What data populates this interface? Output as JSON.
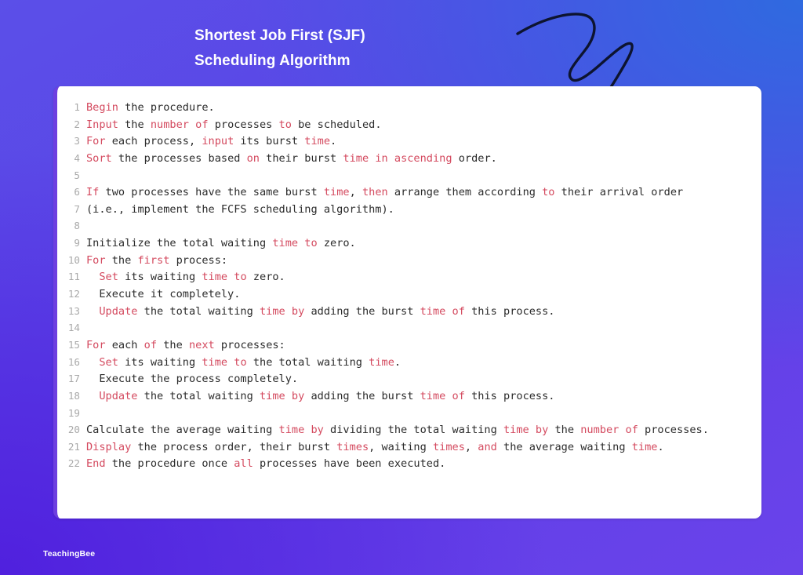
{
  "background": {
    "gradient_from": "#5b4fe8",
    "gradient_to": "#3169dc",
    "gradient_accent": "#5020de"
  },
  "title": {
    "line1": "Shortest Job First (SJF)",
    "line2": "Scheduling Algorithm",
    "color": "#ffffff"
  },
  "doodle": {
    "name": "hand-drawn-squiggle-arrow",
    "color": "#0d1430",
    "direction": "down-left"
  },
  "brand": {
    "name": "TeachingBee",
    "color": "#ffffff"
  },
  "code_card": {
    "background": "#ffffff",
    "accent_border": "#6d3fe0",
    "keyword_color": "#d44a5f",
    "text_color": "#2b2b2b",
    "line_number_color": "#a9a9a9",
    "language": "pseudocode",
    "total_lines": 22,
    "lines": [
      {
        "n": "1",
        "tokens": [
          {
            "t": "Begin",
            "k": true
          },
          {
            "t": " the procedure.",
            "k": false
          }
        ]
      },
      {
        "n": "2",
        "tokens": [
          {
            "t": "Input",
            "k": true
          },
          {
            "t": " the ",
            "k": false
          },
          {
            "t": "number",
            "k": true
          },
          {
            "t": " ",
            "k": false
          },
          {
            "t": "of",
            "k": true
          },
          {
            "t": " processes ",
            "k": false
          },
          {
            "t": "to",
            "k": true
          },
          {
            "t": " be scheduled.",
            "k": false
          }
        ]
      },
      {
        "n": "3",
        "tokens": [
          {
            "t": "For",
            "k": true
          },
          {
            "t": " each process, ",
            "k": false
          },
          {
            "t": "input",
            "k": true
          },
          {
            "t": " its burst ",
            "k": false
          },
          {
            "t": "time",
            "k": true
          },
          {
            "t": ".",
            "k": false
          }
        ]
      },
      {
        "n": "4",
        "tokens": [
          {
            "t": "Sort",
            "k": true
          },
          {
            "t": " the processes based ",
            "k": false
          },
          {
            "t": "on",
            "k": true
          },
          {
            "t": " their burst ",
            "k": false
          },
          {
            "t": "time in ascending",
            "k": true
          },
          {
            "t": " order.",
            "k": false
          }
        ]
      },
      {
        "n": "5",
        "tokens": [
          {
            "t": "",
            "k": false
          }
        ]
      },
      {
        "n": "6",
        "tokens": [
          {
            "t": "If",
            "k": true
          },
          {
            "t": " two processes have the same burst ",
            "k": false
          },
          {
            "t": "time",
            "k": true
          },
          {
            "t": ", ",
            "k": false
          },
          {
            "t": "then",
            "k": true
          },
          {
            "t": " arrange them according ",
            "k": false
          },
          {
            "t": "to",
            "k": true
          },
          {
            "t": " their arrival order",
            "k": false
          }
        ]
      },
      {
        "n": "7",
        "tokens": [
          {
            "t": "(i.e., implement the FCFS scheduling algorithm).",
            "k": false
          }
        ]
      },
      {
        "n": "8",
        "tokens": [
          {
            "t": "",
            "k": false
          }
        ]
      },
      {
        "n": "9",
        "tokens": [
          {
            "t": "Initialize the total waiting ",
            "k": false
          },
          {
            "t": "time to",
            "k": true
          },
          {
            "t": " zero.",
            "k": false
          }
        ]
      },
      {
        "n": "10",
        "tokens": [
          {
            "t": "For",
            "k": true
          },
          {
            "t": " the ",
            "k": false
          },
          {
            "t": "first",
            "k": true
          },
          {
            "t": " process:",
            "k": false
          }
        ]
      },
      {
        "n": "11",
        "tokens": [
          {
            "t": "  ",
            "k": false
          },
          {
            "t": "Set",
            "k": true
          },
          {
            "t": " its waiting ",
            "k": false
          },
          {
            "t": "time to",
            "k": true
          },
          {
            "t": " zero.",
            "k": false
          }
        ]
      },
      {
        "n": "12",
        "tokens": [
          {
            "t": "  Execute it completely.",
            "k": false
          }
        ]
      },
      {
        "n": "13",
        "tokens": [
          {
            "t": "  ",
            "k": false
          },
          {
            "t": "Update",
            "k": true
          },
          {
            "t": " the total waiting ",
            "k": false
          },
          {
            "t": "time by",
            "k": true
          },
          {
            "t": " adding the burst ",
            "k": false
          },
          {
            "t": "time of",
            "k": true
          },
          {
            "t": " this process.",
            "k": false
          }
        ]
      },
      {
        "n": "14",
        "tokens": [
          {
            "t": "",
            "k": false
          }
        ]
      },
      {
        "n": "15",
        "tokens": [
          {
            "t": "For",
            "k": true
          },
          {
            "t": " each ",
            "k": false
          },
          {
            "t": "of",
            "k": true
          },
          {
            "t": " the ",
            "k": false
          },
          {
            "t": "next",
            "k": true
          },
          {
            "t": " processes:",
            "k": false
          }
        ]
      },
      {
        "n": "16",
        "tokens": [
          {
            "t": "  ",
            "k": false
          },
          {
            "t": "Set",
            "k": true
          },
          {
            "t": " its waiting ",
            "k": false
          },
          {
            "t": "time to",
            "k": true
          },
          {
            "t": " the total waiting ",
            "k": false
          },
          {
            "t": "time",
            "k": true
          },
          {
            "t": ".",
            "k": false
          }
        ]
      },
      {
        "n": "17",
        "tokens": [
          {
            "t": "  Execute the process completely.",
            "k": false
          }
        ]
      },
      {
        "n": "18",
        "tokens": [
          {
            "t": "  ",
            "k": false
          },
          {
            "t": "Update",
            "k": true
          },
          {
            "t": " the total waiting ",
            "k": false
          },
          {
            "t": "time by",
            "k": true
          },
          {
            "t": " adding the burst ",
            "k": false
          },
          {
            "t": "time of",
            "k": true
          },
          {
            "t": " this process.",
            "k": false
          }
        ]
      },
      {
        "n": "19",
        "tokens": [
          {
            "t": "",
            "k": false
          }
        ]
      },
      {
        "n": "20",
        "tokens": [
          {
            "t": "Calculate the average waiting ",
            "k": false
          },
          {
            "t": "time by",
            "k": true
          },
          {
            "t": " dividing the total waiting ",
            "k": false
          },
          {
            "t": "time by",
            "k": true
          },
          {
            "t": " the ",
            "k": false
          },
          {
            "t": "number of",
            "k": true
          },
          {
            "t": " processes.",
            "k": false
          }
        ]
      },
      {
        "n": "21",
        "tokens": [
          {
            "t": "Display",
            "k": true
          },
          {
            "t": " the process order, their burst ",
            "k": false
          },
          {
            "t": "times",
            "k": true
          },
          {
            "t": ", waiting ",
            "k": false
          },
          {
            "t": "times",
            "k": true
          },
          {
            "t": ", ",
            "k": false
          },
          {
            "t": "and",
            "k": true
          },
          {
            "t": " the average waiting ",
            "k": false
          },
          {
            "t": "time",
            "k": true
          },
          {
            "t": ".",
            "k": false
          }
        ]
      },
      {
        "n": "22",
        "tokens": [
          {
            "t": "End",
            "k": true
          },
          {
            "t": " the procedure once ",
            "k": false
          },
          {
            "t": "all",
            "k": true
          },
          {
            "t": " processes have been executed.",
            "k": false
          }
        ]
      }
    ]
  }
}
